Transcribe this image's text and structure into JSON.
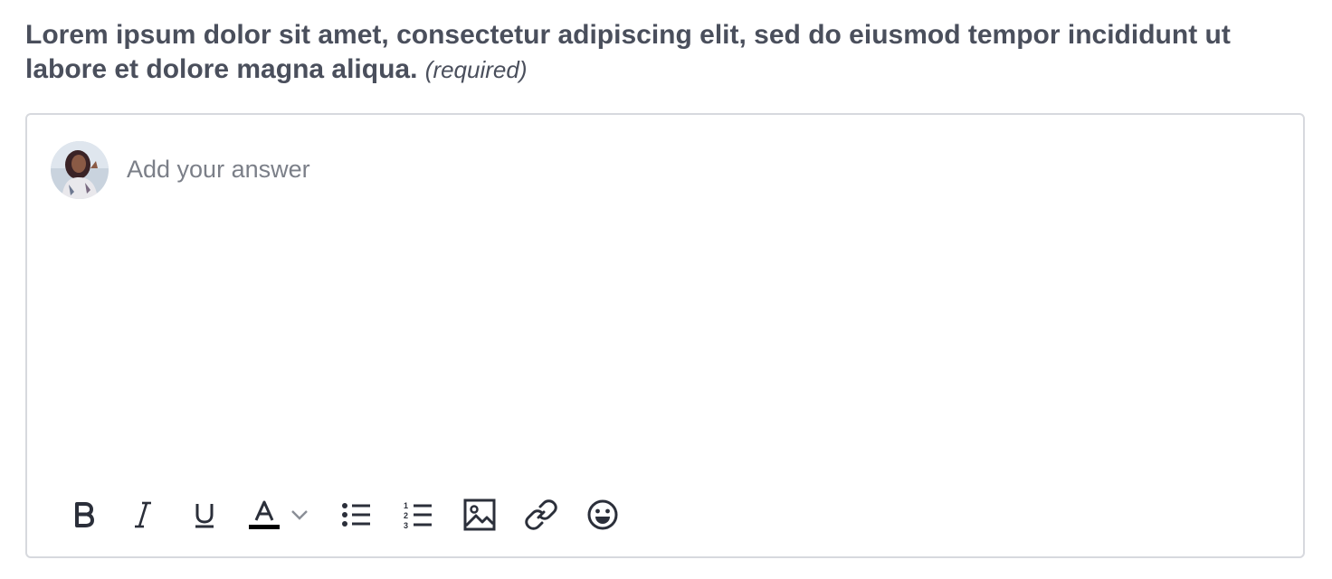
{
  "question": {
    "text": "Lorem ipsum dolor sit amet, consectetur adipiscing elit, sed do eiusmod tempor incididunt ut labore et dolore magna aliqua.",
    "required_label": "(required)"
  },
  "editor": {
    "placeholder": "Add your answer",
    "value": "",
    "avatar_icon": "user-avatar-photo"
  },
  "toolbar": {
    "buttons": [
      {
        "icon": "bold-icon",
        "label": "Bold"
      },
      {
        "icon": "italic-icon",
        "label": "Italic"
      },
      {
        "icon": "underline-icon",
        "label": "Underline"
      },
      {
        "icon": "text-color-icon",
        "label": "Text color"
      },
      {
        "icon": "chevron-down-icon",
        "label": "Text color options"
      },
      {
        "icon": "bulleted-list-icon",
        "label": "Bulleted list"
      },
      {
        "icon": "numbered-list-icon",
        "label": "Numbered list"
      },
      {
        "icon": "image-icon",
        "label": "Insert image"
      },
      {
        "icon": "link-icon",
        "label": "Insert link"
      },
      {
        "icon": "emoji-icon",
        "label": "Insert emoji"
      }
    ]
  },
  "colors": {
    "text_dark": "#4a4f5c",
    "border": "#d7d9de",
    "placeholder": "#7b7f88",
    "icon": "#2b2f3a",
    "text_color_swatch": "#000000"
  }
}
